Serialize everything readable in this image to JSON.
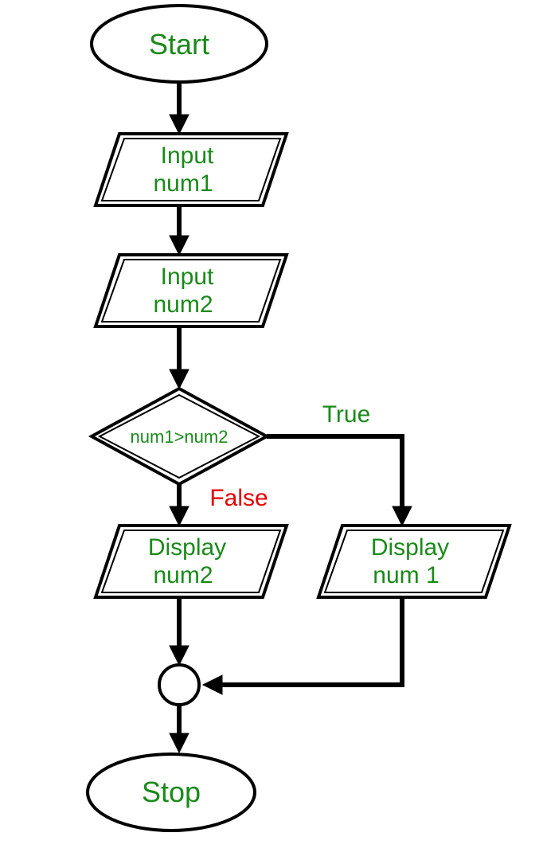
{
  "flow": {
    "start": "Start",
    "input1_line1": "Input",
    "input1_line2": "num1",
    "input2_line1": "Input",
    "input2_line2": "num2",
    "decision": "num1>num2",
    "branch_true": "True",
    "branch_false": "False",
    "display_false_line1": "Display",
    "display_false_line2": "num2",
    "display_true_line1": "Display",
    "display_true_line2": "num 1",
    "stop": "Stop"
  }
}
